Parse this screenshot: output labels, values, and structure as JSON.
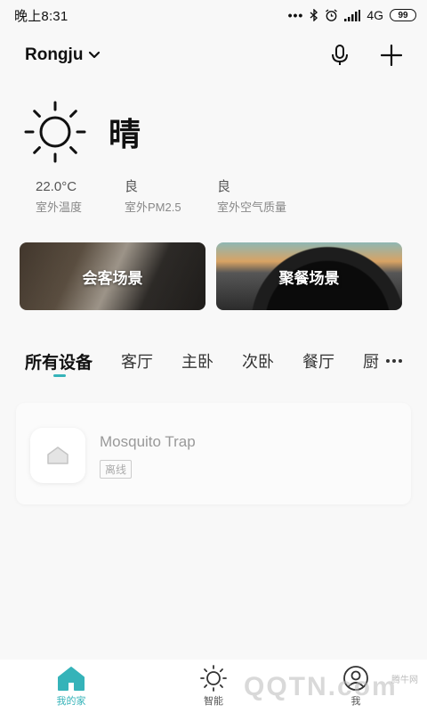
{
  "status_bar": {
    "time": "晚上8:31",
    "dots": "•••",
    "network": "4G",
    "battery": "99"
  },
  "header": {
    "home_name": "Rongju",
    "icons": [
      "chevron-down-icon",
      "microphone-icon",
      "plus-icon"
    ]
  },
  "weather": {
    "icon": "sun-icon",
    "condition": "晴",
    "stats": [
      {
        "value": "22.0°C",
        "label": "室外温度"
      },
      {
        "value": "良",
        "label": "室外PM2.5"
      },
      {
        "value": "良",
        "label": "室外空气质量"
      }
    ]
  },
  "scenes": [
    {
      "title": "会客场景"
    },
    {
      "title": "聚餐场景"
    }
  ],
  "rooms": {
    "tabs": [
      "所有设备",
      "客厅",
      "主卧",
      "次卧",
      "餐厅",
      "厨"
    ],
    "active_index": 0,
    "accent": "#35b3b9"
  },
  "devices": [
    {
      "name": "Mosquito Trap",
      "status": "离线",
      "icon": "home-icon"
    }
  ],
  "bottom_nav": [
    {
      "label": "我的家",
      "icon": "home-icon",
      "active": true
    },
    {
      "label": "智能",
      "icon": "sun-icon",
      "active": false
    },
    {
      "label": "我",
      "icon": "user-icon",
      "active": false
    }
  ],
  "watermark": {
    "text": "QQTN.com",
    "small": "腾牛网"
  }
}
